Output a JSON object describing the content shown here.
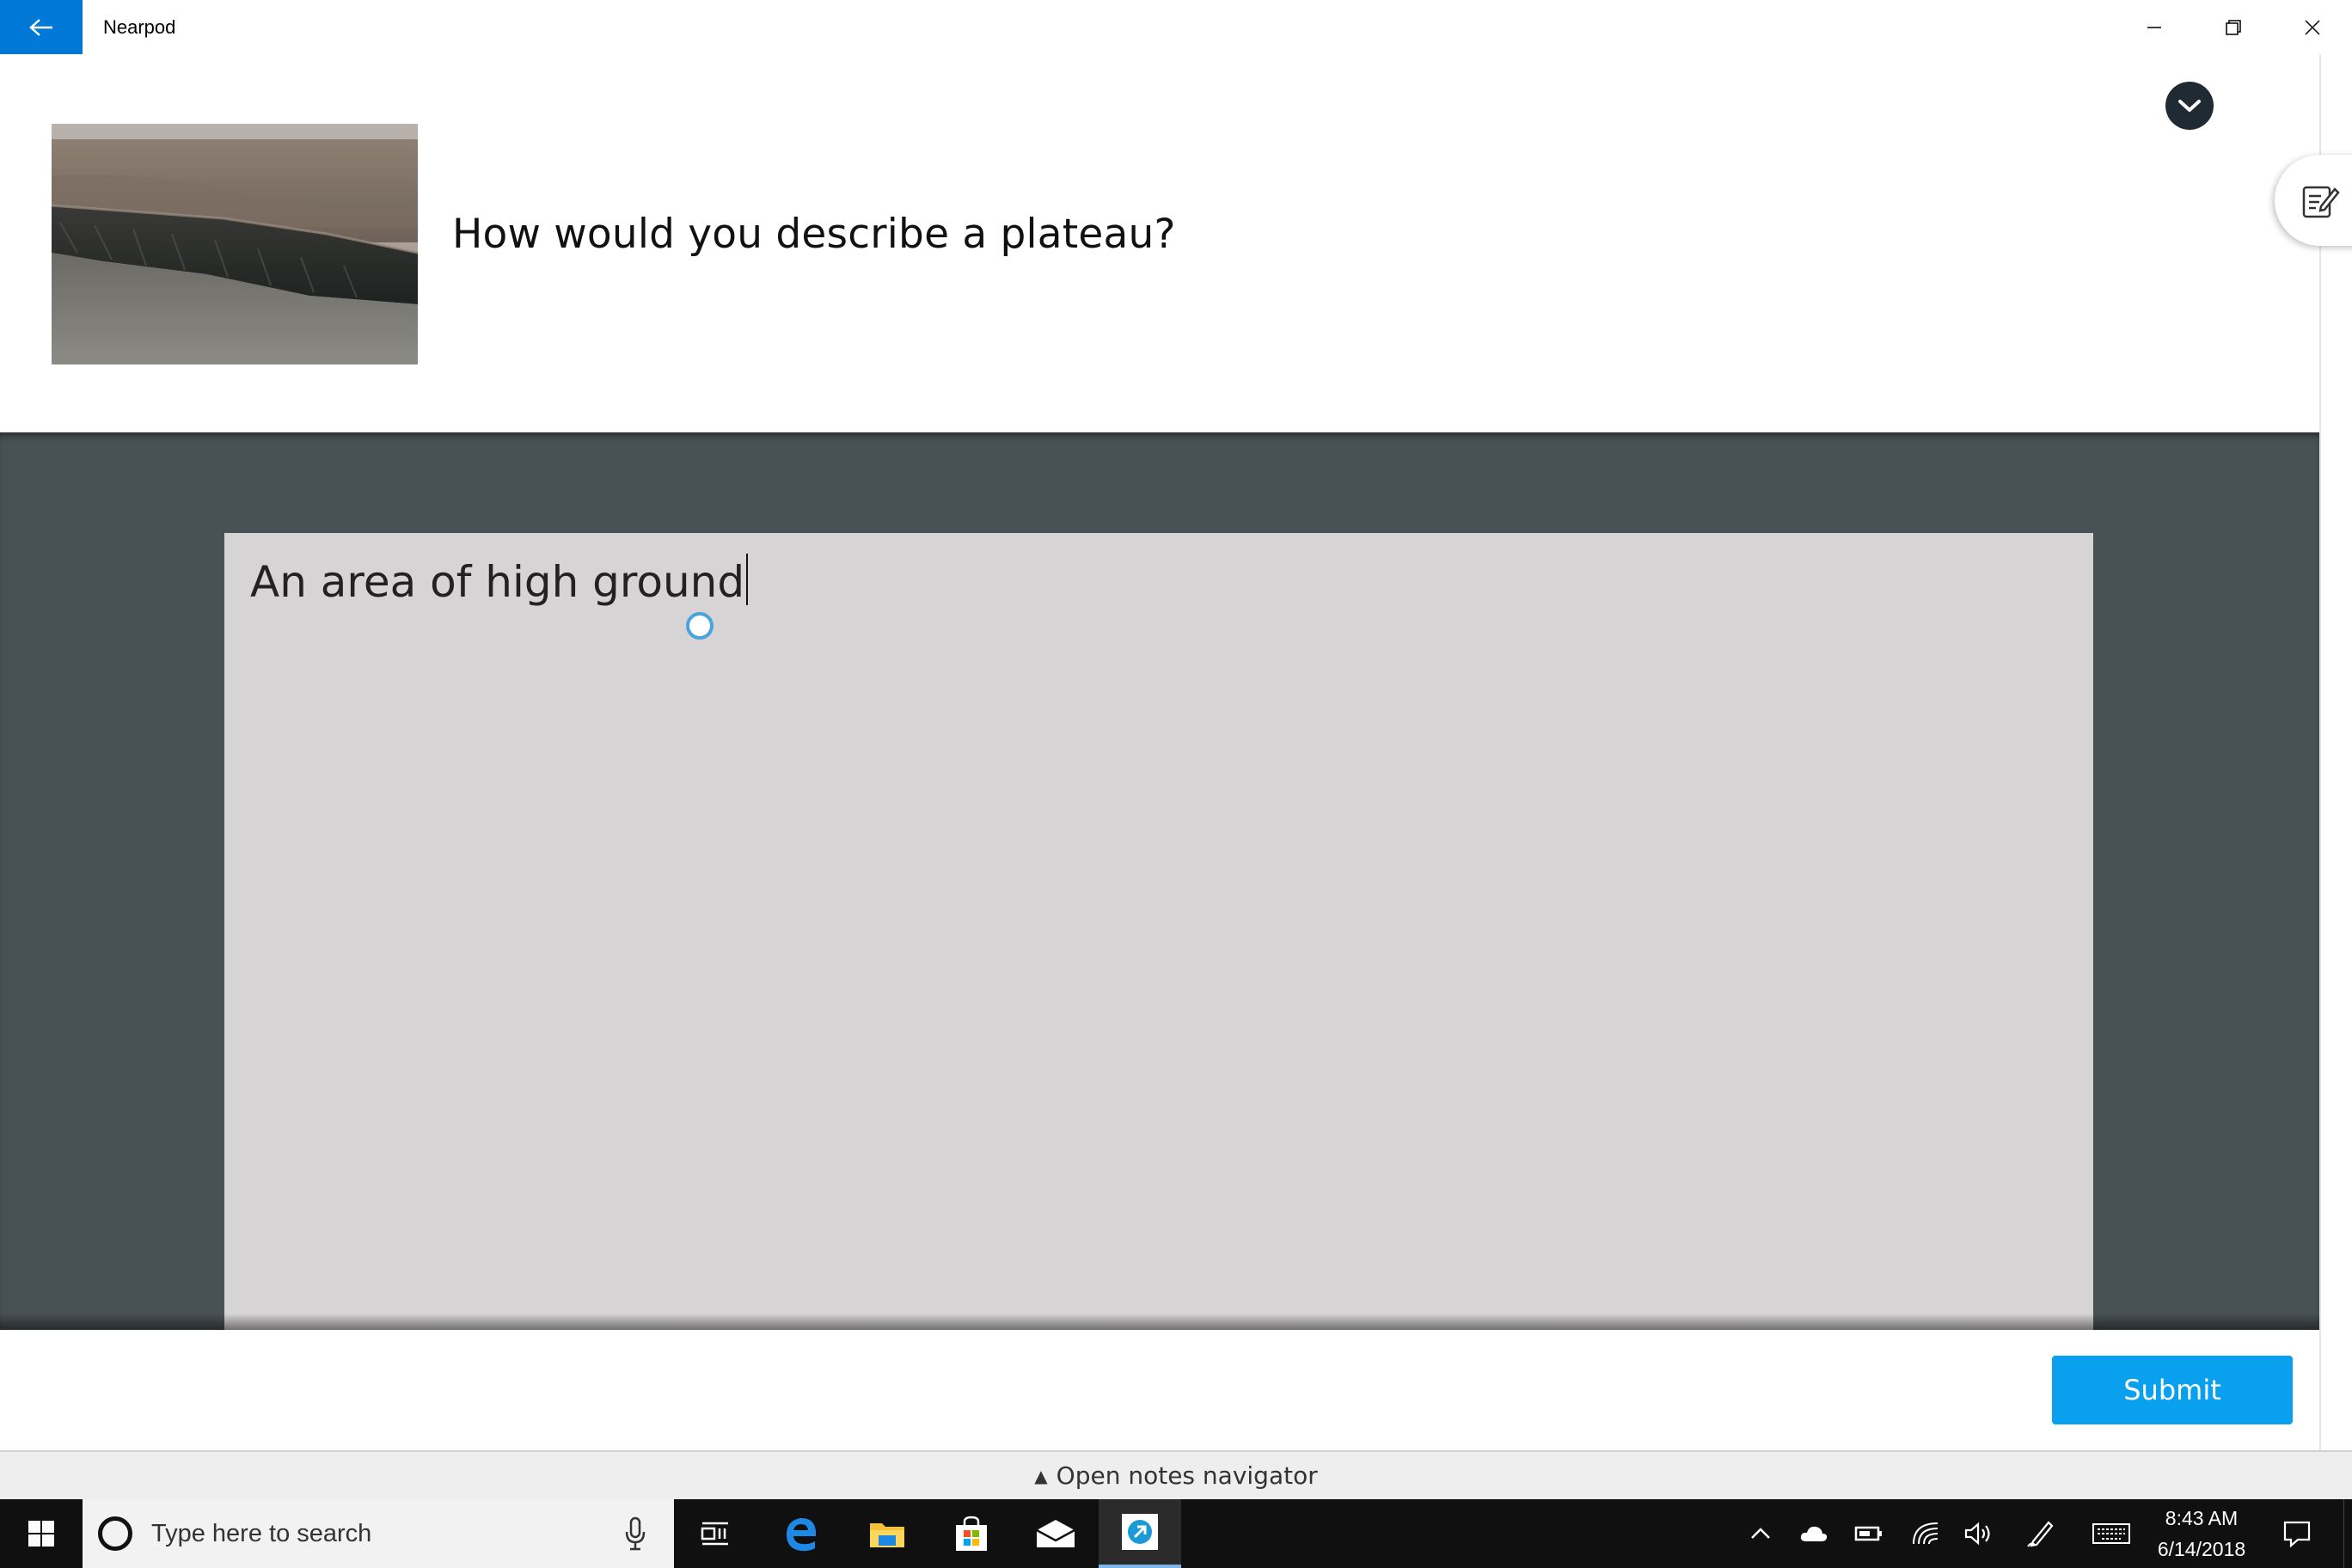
{
  "window": {
    "title": "Nearpod"
  },
  "question": {
    "text": "How would you describe a plateau?"
  },
  "answer": {
    "value": "An area of high ground"
  },
  "footer": {
    "submit_label": "Submit",
    "notes_navigator_label": "Open notes navigator"
  },
  "taskbar": {
    "search_placeholder": "Type here to search",
    "apps": [
      "task-view",
      "microsoft-edge",
      "file-explorer",
      "microsoft-store",
      "mail",
      "nearpod"
    ],
    "time": "8:43 AM",
    "date": "6/14/2018"
  },
  "colors": {
    "accent": "#0078d7",
    "submit": "#0aa0f0",
    "answer_area_bg": "#485153",
    "answer_box_bg": "#d6d4d5",
    "taskbar_bg": "#101010"
  },
  "icons": {
    "back": "arrow-left-icon",
    "collapse": "chevron-down-icon",
    "notes": "edit-note-icon"
  }
}
